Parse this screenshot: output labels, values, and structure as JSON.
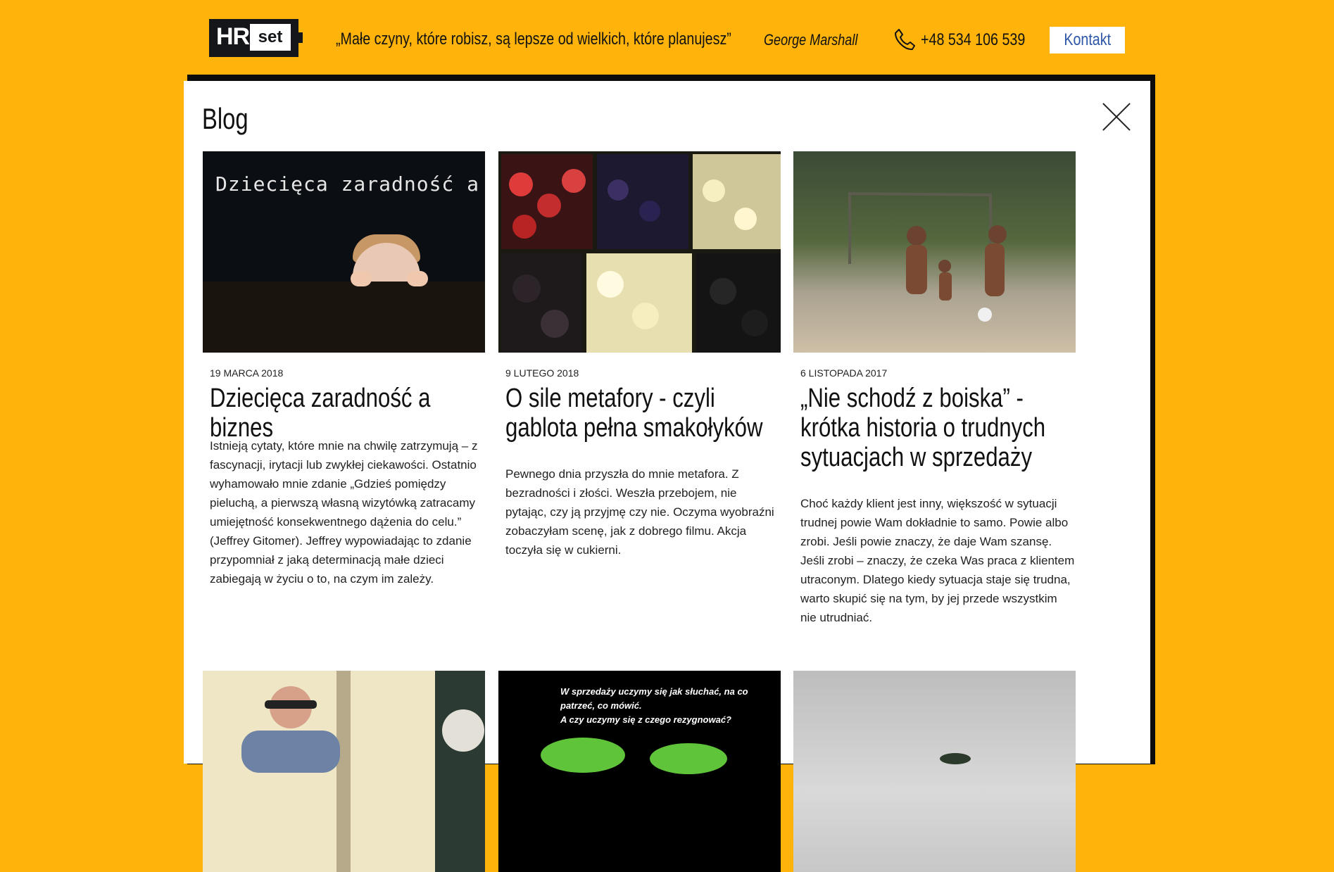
{
  "header": {
    "logo_hr": "HR",
    "logo_set": "set",
    "quote": "„Małe czyny, które robisz, są lepsze od wielkich, które planujesz”",
    "author": "George Marshall",
    "phone": "+48 534 106 539",
    "contact_button": "Kontakt"
  },
  "panel": {
    "title": "Blog",
    "posts": [
      {
        "date": "19 MARCA 2018",
        "title": "Dziecięca zaradność a biznes",
        "excerpt": "Istnieją cytaty, które mnie na chwilę zatrzymują – z fascynacji, irytacji lub zwykłej ciekawości. Ostatnio wyhamowało mnie zdanie „Gdzieś pomiędzy pieluchą, a pierwszą własną wizytówką zatracamy umiejętność konsekwentnego dążenia do celu.” (Jeffrey Gitomer). Jeffrey wypowiadając to zdanie przypomniał z jaką determinacją małe dzieci zabiegają w życiu o to, na czym im zależy.",
        "image_text": "Dziecięca zaradność a bizn"
      },
      {
        "date": "9 LUTEGO 2018",
        "title": "O sile metafory - czyli gablota pełna smakołyków",
        "excerpt": "Pewnego dnia przyszła do mnie metafora. Z bezradności i złości. Weszła przebojem, nie pytając, czy ją przyjmę czy nie. Oczyma wyobraźni zobaczyłam scenę, jak z dobrego filmu. Akcja toczyła się w cukierni."
      },
      {
        "date": "6 LISTOPADA 2017",
        "title": "„Nie schodź z boiska” - krótka historia o trudnych sytuacjach w sprzedaży",
        "excerpt": "Choć każdy klient jest inny, większość w sytuacji trudnej powie Wam dokładnie to samo. Powie albo zrobi. Jeśli powie znaczy, że daje Wam szansę. Jeśli zrobi – znaczy, że czeka Was praca z klientem utraconym. Dlatego kiedy sytuacja staje się trudna, warto skupić się na tym, by jej przede wszystkim nie utrudniać."
      },
      {
        "image": "meeting-photo"
      },
      {
        "image_text_line1": "W sprzedaży uczymy się jak słuchać, na co patrzeć, co mówić.",
        "image_text_line2": "A czy uczymy się z czego rezygnować?"
      },
      {
        "image": "cloudy-sky-photo"
      }
    ]
  },
  "colors": {
    "background": "#FFB30B",
    "logo_dark": "#14161a",
    "button_text": "#2d56a8"
  }
}
